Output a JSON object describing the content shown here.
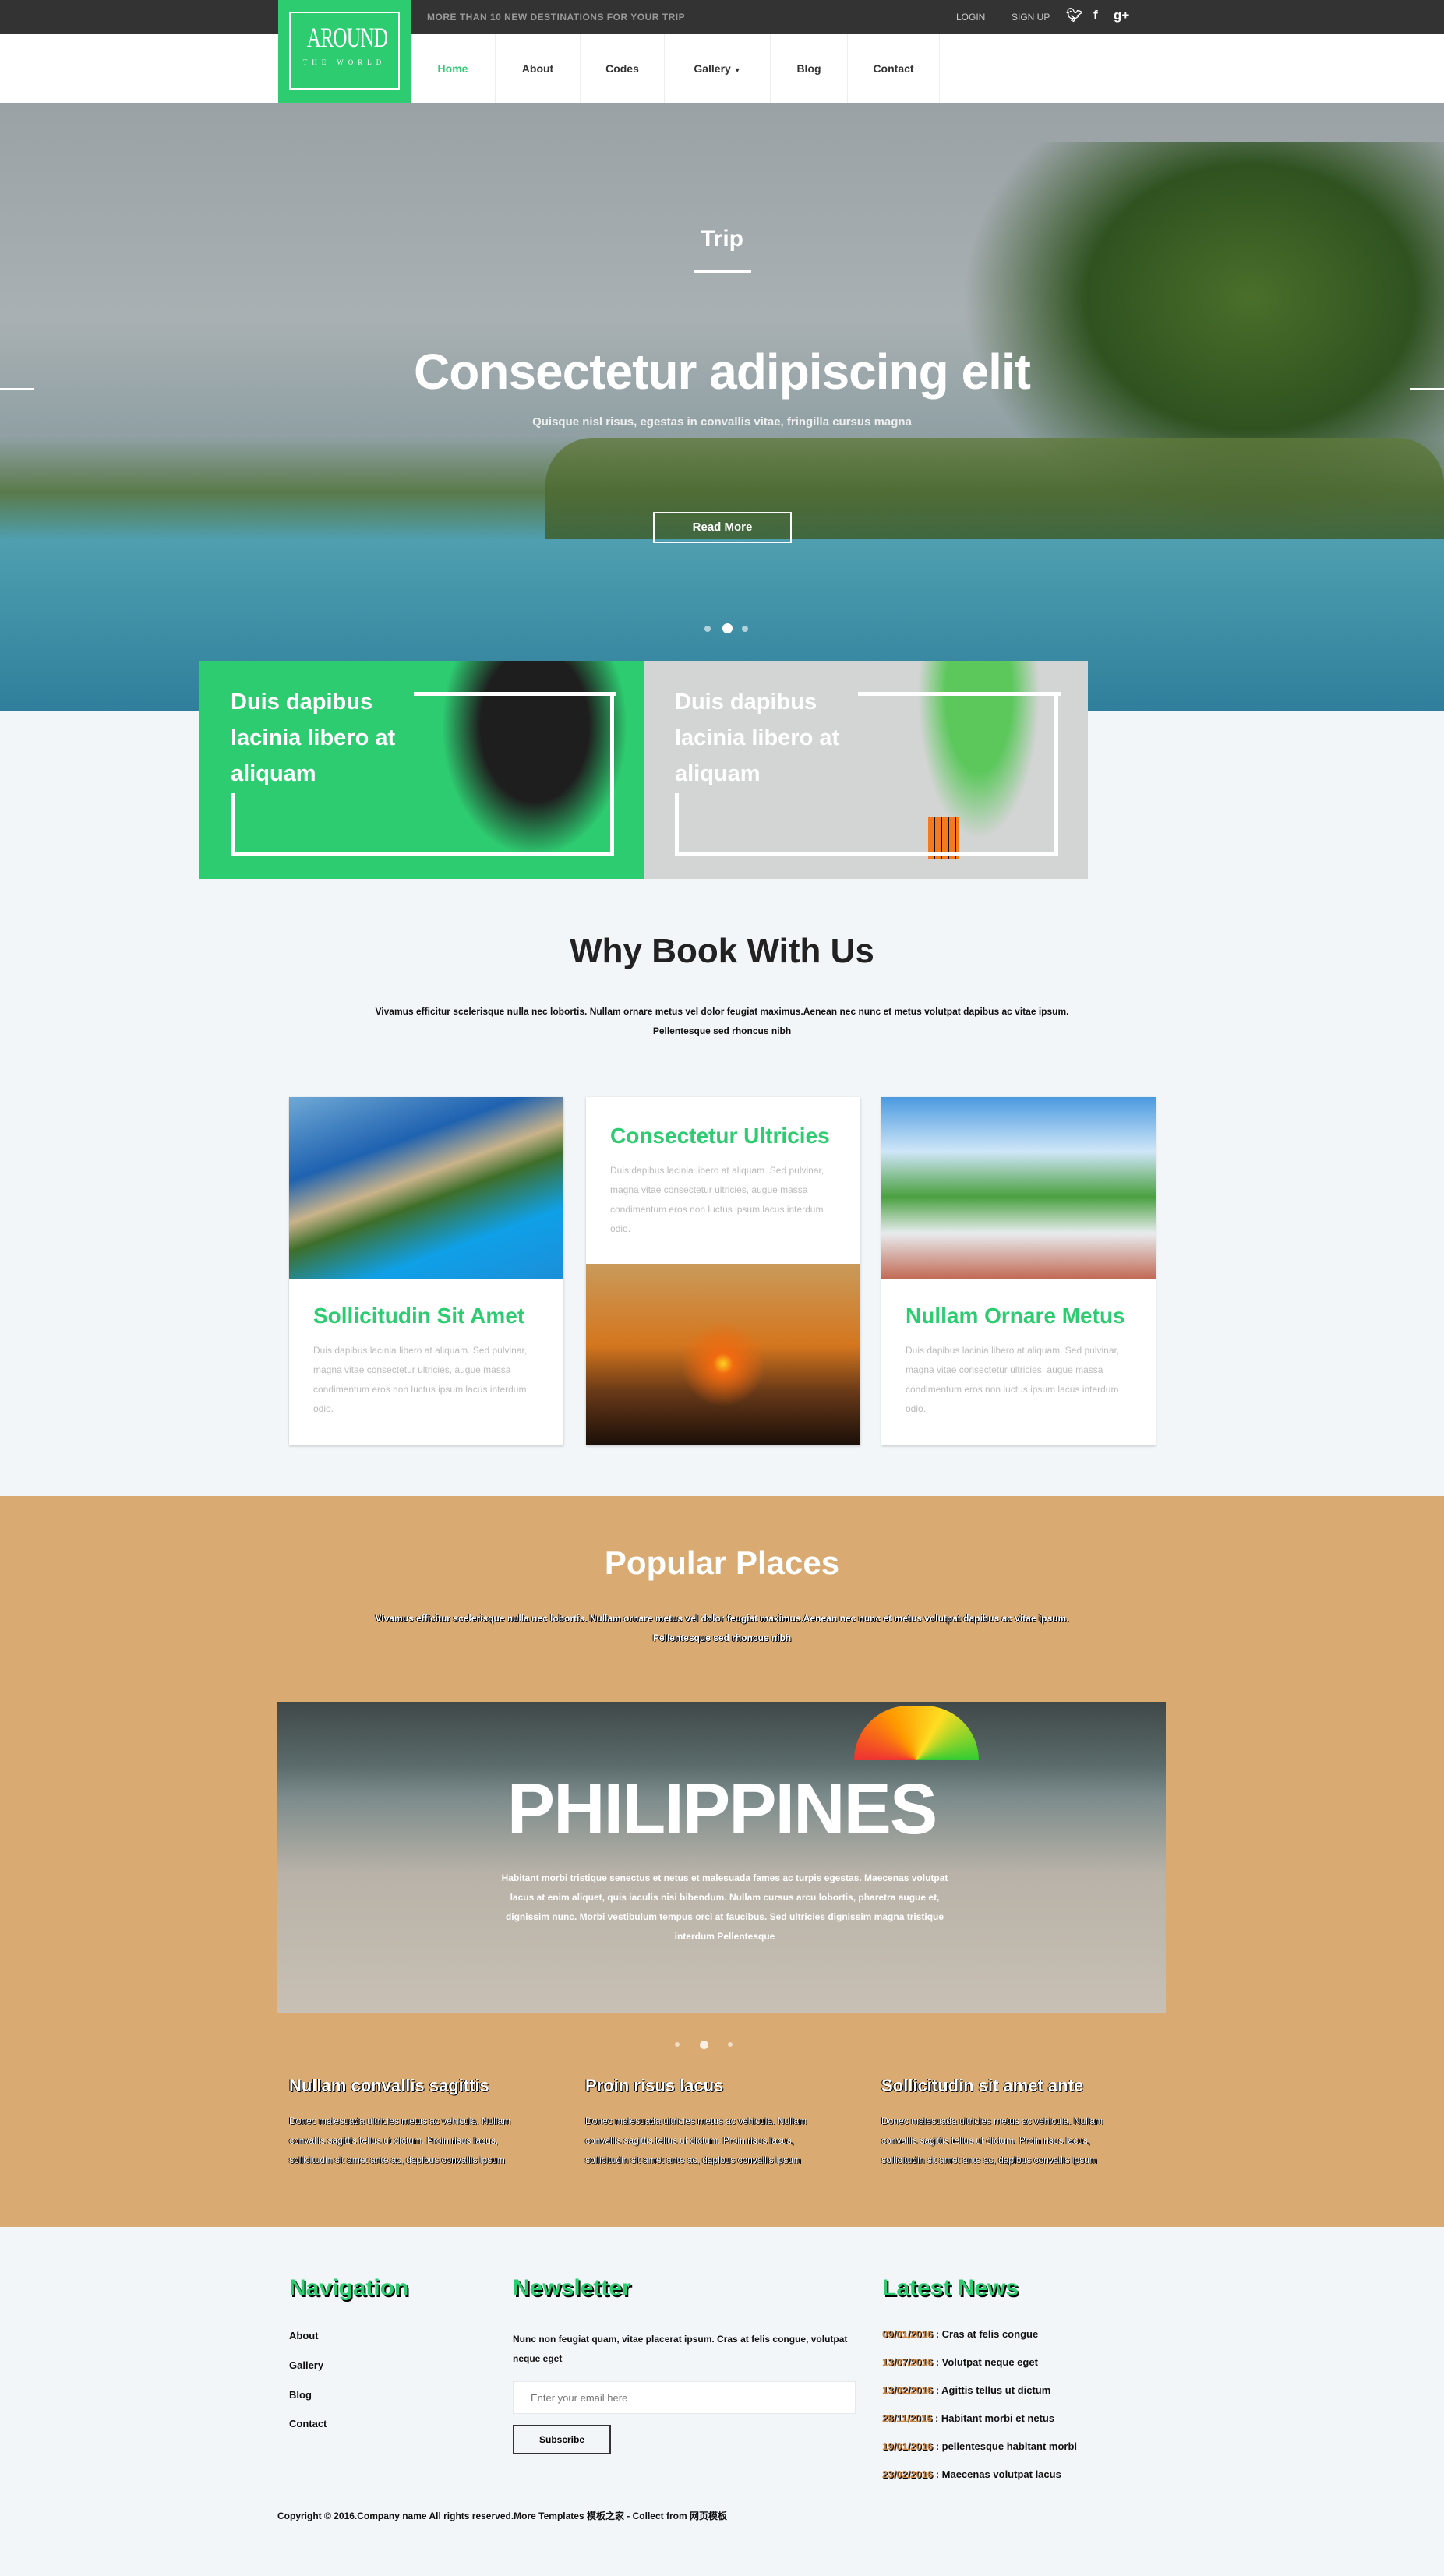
{
  "header": {
    "logo_main": "AROUND",
    "logo_sub": "THE WORLD",
    "tagline": "MORE THAN 10 NEW DESTINATIONS FOR YOUR TRIP",
    "login": "LOGIN",
    "signup": "SIGN UP",
    "social": [
      "twitter-icon",
      "facebook-icon",
      "google-plus-icon"
    ]
  },
  "nav": {
    "items": [
      {
        "label": "Home",
        "active": true
      },
      {
        "label": "About"
      },
      {
        "label": "Codes"
      },
      {
        "label": "Gallery",
        "dropdown": true
      },
      {
        "label": "Blog"
      },
      {
        "label": "Contact"
      }
    ]
  },
  "hero": {
    "kicker": "Trip",
    "title": "Consectetur adipiscing elit",
    "subtitle": "Quisque nisl risus, egestas in convallis vitae, fringilla cursus magna",
    "button": "Read More",
    "slides": 3,
    "active_slide": 2
  },
  "features": [
    {
      "text": "Duis dapibus lacinia libero at aliquam",
      "color": "#2ecc71"
    },
    {
      "text": "Duis dapibus lacinia libero at aliquam",
      "color": "#d3d4d4"
    }
  ],
  "why": {
    "title": "Why Book With Us",
    "desc": "Vivamus efficitur scelerisque nulla nec lobortis. Nullam ornare metus vel dolor feugiat maximus.Aenean nec nunc et metus volutpat dapibus ac vitae ipsum. Pellentesque sed rhoncus nibh",
    "cards": [
      {
        "title": "Sollicitudin Sit Amet",
        "text": "Duis dapibus lacinia libero at aliquam. Sed pulvinar, magna vitae consectetur ultricies, augue massa condimentum eros non luctus ipsum lacus interdum odio."
      },
      {
        "title": "Consectetur Ultricies",
        "text": "Duis dapibus lacinia libero at aliquam. Sed pulvinar, magna vitae consectetur ultricies, augue massa condimentum eros non luctus ipsum lacus interdum odio."
      },
      {
        "title": "Nullam Ornare Metus",
        "text": "Duis dapibus lacinia libero at aliquam. Sed pulvinar, magna vitae consectetur ultricies, augue massa condimentum eros non luctus ipsum lacus interdum odio."
      }
    ]
  },
  "popular": {
    "title": "Popular Places",
    "desc": "Vivamus efficitur scelerisque nulla nec lobortis. Nullam ornare metus vel dolor feugiat maximus.Aenean nec nunc et metus volutpat dapibus ac vitae ipsum. Pellentesque sed rhoncus nibh",
    "place": "PHILIPPINES",
    "place_text": "Habitant morbi tristique senectus et netus et malesuada fames ac turpis egestas. Maecenas volutpat lacus at enim aliquet, quis iaculis nisi bibendum. Nullam cursus arcu lobortis, pharetra augue et, dignissim nunc. Morbi vestibulum tempus orci at faucibus. Sed ultricies dignissim magna tristique interdum Pellentesque",
    "slides": 3,
    "active_slide": 2,
    "columns": [
      {
        "title": "Nullam convallis sagittis",
        "text": "Donec malesuada ultricies metus ac vehicula. Nullam convallis sagittis tellus ut dictum. Proin risus lacus, sollicitudin sit amet ante ac, dapibus convallis ipsum"
      },
      {
        "title": "Proin risus lacus",
        "text": "Donec malesuada ultricies metus ac vehicula. Nullam convallis sagittis tellus ut dictum. Proin risus lacus, sollicitudin sit amet ante ac, dapibus convallis ipsum"
      },
      {
        "title": "Sollicitudin sit amet ante",
        "text": "Donec malesuada ultricies metus ac vehicula. Nullam convallis sagittis tellus ut dictum. Proin risus lacus, sollicitudin sit amet ante ac, dapibus convallis ipsum"
      }
    ]
  },
  "footer": {
    "nav_title": "Navigation",
    "nav_links": [
      "About",
      "Gallery",
      "Blog",
      "Contact"
    ],
    "newsletter_title": "Newsletter",
    "newsletter_text": "Nunc non feugiat quam, vitae placerat ipsum. Cras at felis congue, volutpat neque eget",
    "email_placeholder": "Enter your email here",
    "subscribe": "Subscribe",
    "news_title": "Latest News",
    "news": [
      {
        "date": "09/01/2016",
        "text": "Cras at felis congue"
      },
      {
        "date": "13/07/2016",
        "text": "Volutpat neque eget"
      },
      {
        "date": "13/02/2016",
        "text": "Agittis tellus ut dictum"
      },
      {
        "date": "28/11/2016",
        "text": "Habitant morbi et netus"
      },
      {
        "date": "19/01/2016",
        "text": "pellentesque habitant morbi"
      },
      {
        "date": "23/02/2016",
        "text": "Maecenas volutpat lacus"
      }
    ],
    "copyright": "Copyright © 2016.Company name All rights reserved.More Templates 模板之家 - Collect from 网页模板"
  },
  "colors": {
    "accent": "#2ecc71",
    "popular_bg": "#d9aa72",
    "topbar": "#333333"
  }
}
